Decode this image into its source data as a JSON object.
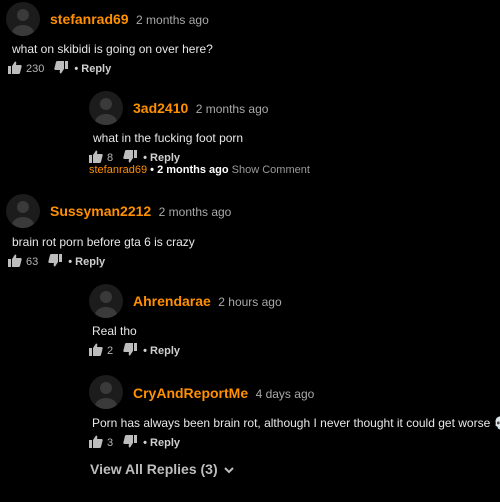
{
  "colors": {
    "username": "#ff9000",
    "background": "#000000",
    "text": "#e8e8e8",
    "muted": "#a9a9a9"
  },
  "comments": [
    {
      "username": "stefanrad69",
      "time": "2 months ago",
      "text": "what on skibidi is going on over here?",
      "likes": "230",
      "reply_label": "• Reply"
    },
    {
      "username": "3ad2410",
      "time": "2 months ago",
      "text": "what in the fucking foot porn",
      "likes": "8",
      "reply_label": "• Reply",
      "reply_to": {
        "username": "stefanrad69",
        "time": "• 2 months ago",
        "show_label": "Show Comment"
      }
    },
    {
      "username": "Sussyman2212",
      "time": "2 months ago",
      "text": "brain rot porn before gta 6 is crazy",
      "likes": "63",
      "reply_label": "• Reply"
    },
    {
      "username": "Ahrendarae",
      "time": "2 hours ago",
      "text": "Real tho",
      "likes": "2",
      "reply_label": "• Reply"
    },
    {
      "username": "CryAndReportMe",
      "time": "4 days ago",
      "text": "Porn has always been brain rot, although I never thought it could get worse 💀",
      "likes": "3",
      "reply_label": "• Reply"
    }
  ],
  "view_all": {
    "label": "View All Replies (3)",
    "icon": "chevron-down-icon"
  },
  "icons": {
    "avatar": "default-user-icon",
    "like": "thumbs-up-icon",
    "dislike": "thumbs-down-icon"
  }
}
